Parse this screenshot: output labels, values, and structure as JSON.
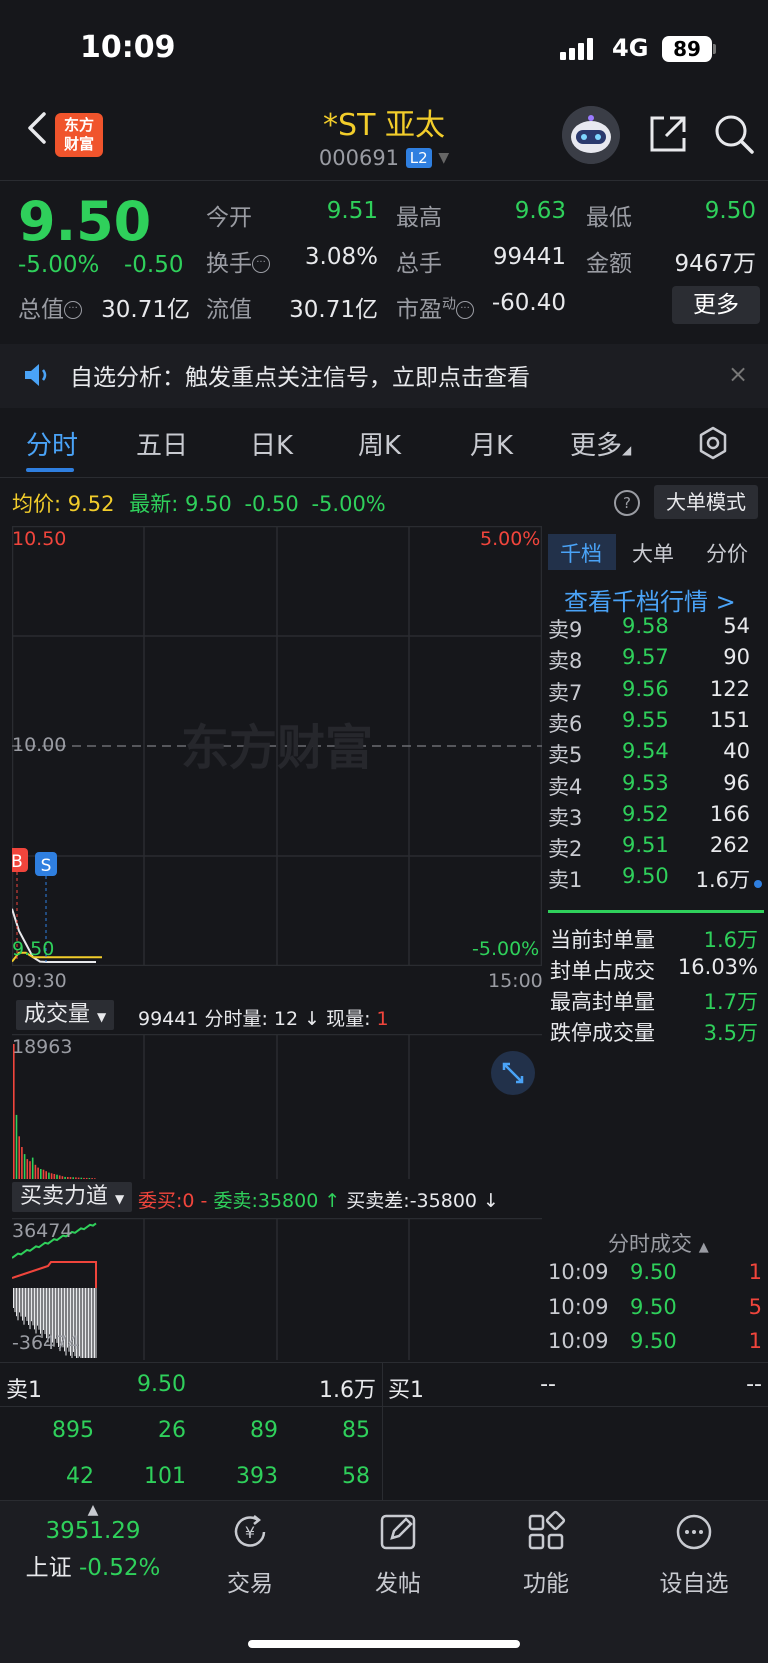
{
  "status_bar": {
    "time": "10:09",
    "network": "4G",
    "battery": "89"
  },
  "header": {
    "stock_name": "*ST 亚太",
    "stock_code": "000691",
    "level_badge": "L2",
    "logo_line1": "东方",
    "logo_line2": "财富"
  },
  "quote": {
    "price": "9.50",
    "change_pct": "-5.00%",
    "change_abs": "-0.50",
    "fields": [
      {
        "label": "今开",
        "value": "9.51"
      },
      {
        "label": "最高",
        "value": "9.63"
      },
      {
        "label": "最低",
        "value": "9.50"
      },
      {
        "label": "换手",
        "value": "3.08%"
      },
      {
        "label": "总手",
        "value": "99441"
      },
      {
        "label": "金额",
        "value": "9467万"
      },
      {
        "label": "总值",
        "value": "30.71亿"
      },
      {
        "label": "流值",
        "value": "30.71亿"
      },
      {
        "label": "市盈",
        "label_sup": "动",
        "value": "-60.40"
      }
    ],
    "more_label": "更多"
  },
  "notice": {
    "text": "自选分析：触发重点关注信号，立即点击查看",
    "close": "×"
  },
  "tabs": [
    "分时",
    "五日",
    "日K",
    "周K",
    "月K",
    "更多"
  ],
  "chart_header": {
    "avg_label": "均价:",
    "avg_value": "9.52",
    "latest_label": "最新:",
    "latest_value": "9.50",
    "latest_change": "-0.50",
    "latest_pct": "-5.00%",
    "help": "?",
    "big_order_mode": "大单模式"
  },
  "chart_data": [
    {
      "type": "line",
      "y_axis_left": [
        "10.50",
        "10.00",
        "9.50"
      ],
      "y_axis_right": [
        "5.00%",
        "-5.00%"
      ],
      "x_axis": [
        "09:30",
        "15:00"
      ],
      "ylim": [
        9.5,
        10.5
      ],
      "reference": 10.0,
      "series": [
        {
          "values": [
            9.63,
            9.58,
            9.55,
            9.52,
            9.51,
            9.5,
            9.5,
            9.5,
            9.5,
            9.5,
            9.5,
            9.5,
            9.5
          ]
        },
        {
          "values": [
            9.51,
            9.53,
            9.53,
            9.52,
            9.52,
            9.52,
            9.52,
            9.52,
            9.52,
            9.52,
            9.52,
            9.52,
            9.52
          ]
        }
      ],
      "markers": [
        "B",
        "S"
      ]
    },
    {
      "type": "bar",
      "title": "成交量",
      "ymax_label": "18963",
      "ylim": [
        0,
        18963
      ],
      "values": [
        18963,
        9000,
        6000,
        4500,
        3500,
        2800,
        2500,
        3000,
        2000,
        1600,
        1400,
        1300,
        1100,
        900,
        800,
        700,
        600,
        500,
        400,
        300,
        280,
        260,
        240,
        220,
        200,
        180,
        160,
        150,
        140,
        120,
        100
      ]
    },
    {
      "type": "area",
      "title": "买卖力道",
      "ymax_label": "36474",
      "ymin_label": "-36474",
      "ylim": [
        -36474,
        36474
      ]
    }
  ],
  "volume_header": {
    "label": "成交量",
    "summary": "99441 分时量: 12 ↓ 现量: ",
    "now_qty": "1"
  },
  "force_header": {
    "label": "买卖力道",
    "buy": "委买:0 -",
    "sell": "委卖:35800 ↑",
    "diff": "买卖差:-35800 ↓"
  },
  "order_book": {
    "tabs": [
      "千档",
      "大单",
      "分价"
    ],
    "view_link": "查看千档行情 >",
    "asks": [
      {
        "label": "卖9",
        "price": "9.58",
        "qty": "54"
      },
      {
        "label": "卖8",
        "price": "9.57",
        "qty": "90"
      },
      {
        "label": "卖7",
        "price": "9.56",
        "qty": "122"
      },
      {
        "label": "卖6",
        "price": "9.55",
        "qty": "151"
      },
      {
        "label": "卖5",
        "price": "9.54",
        "qty": "40"
      },
      {
        "label": "卖4",
        "price": "9.53",
        "qty": "96"
      },
      {
        "label": "卖3",
        "price": "9.52",
        "qty": "166"
      },
      {
        "label": "卖2",
        "price": "9.51",
        "qty": "262"
      },
      {
        "label": "卖1",
        "price": "9.50",
        "qty": "1.6万"
      }
    ],
    "seal": [
      {
        "label": "当前封单量",
        "value": "1.6万"
      },
      {
        "label": "封单占成交",
        "value": "16.03%"
      },
      {
        "label": "最高封单量",
        "value": "1.7万"
      },
      {
        "label": "跌停成交量",
        "value": "3.5万"
      }
    ],
    "trades_title": "分时成交",
    "trades": [
      {
        "time": "10:09",
        "price": "9.50",
        "qty": "1",
        "qty_color": "red"
      },
      {
        "time": "10:09",
        "price": "9.50",
        "qty": "5",
        "qty_color": "red"
      },
      {
        "time": "10:09",
        "price": "9.50",
        "qty": "1",
        "qty_color": "red"
      }
    ]
  },
  "strip": {
    "sell_label": "卖1",
    "sell_price": "9.50",
    "sell_qty": "1.6万",
    "buy_label": "买1",
    "buy_price": "--",
    "buy_qty": "--",
    "queue_row1": [
      "895",
      "26",
      "89",
      "85"
    ],
    "queue_row2": [
      "42",
      "101",
      "393",
      "58"
    ]
  },
  "bottom_nav": {
    "index_value": "3951.29",
    "index_label": "上证",
    "index_change": "-0.52%",
    "items": [
      "交易",
      "发帖",
      "功能",
      "设自选"
    ]
  },
  "colors": {
    "up": "#f0453c",
    "down": "#2fd05b",
    "accent": "#2f7fe0",
    "highlight": "#f2cd2b"
  }
}
